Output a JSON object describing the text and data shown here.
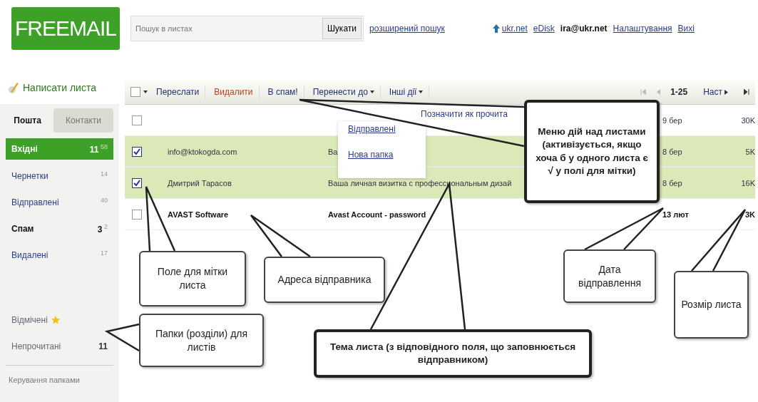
{
  "logo": "FREEMAIL",
  "search": {
    "placeholder": "Пошук в листах",
    "button": "Шукати",
    "advanced_link": "розширений пошук"
  },
  "top_links": [
    {
      "kind": "home",
      "label": "ukr.net"
    },
    {
      "kind": "link",
      "label": "eDisk"
    },
    {
      "kind": "account",
      "label": "ira@ukr.net"
    },
    {
      "kind": "link",
      "label": "Налаштування"
    },
    {
      "kind": "link",
      "label": "Вихі"
    }
  ],
  "compose": "Написати листа",
  "sidebar": {
    "tabs": [
      {
        "label": "Пошта",
        "selected": true
      },
      {
        "label": "Контакти",
        "selected": false
      }
    ],
    "folders": [
      {
        "label": "Вхідні",
        "count": "11",
        "total": "58",
        "selected": true
      },
      {
        "label": "Чернетки",
        "total": "14",
        "selected": false
      },
      {
        "label": "Відправлені",
        "total": "40",
        "selected": false
      },
      {
        "label": "Спам",
        "count": "3",
        "total": "2",
        "selected": false
      },
      {
        "label": "Видалені",
        "total": "17",
        "selected": false
      }
    ],
    "filters": [
      {
        "kind": "starred",
        "label": "Відмічені",
        "selected": false
      },
      {
        "kind": "plain",
        "label": "Непрочитані",
        "count": "11",
        "selected": false
      }
    ],
    "manage_folders": "Керування папками"
  },
  "toolbar": {
    "select_all": {
      "checked": false
    },
    "actions": [
      {
        "kind": "button",
        "label": "Переслати"
      },
      {
        "kind": "danger",
        "label": "Видалити"
      },
      {
        "kind": "button",
        "label": "В спам!"
      },
      {
        "kind": "dropdown",
        "label": "Перенести до"
      },
      {
        "kind": "dropdown",
        "label": "Інші дії"
      }
    ],
    "pager": {
      "range": "1-25",
      "next": "Наст"
    }
  },
  "move_menu": {
    "items": [
      "Відправлені",
      "Нова папка"
    ]
  },
  "other_menu": {
    "items": [
      "Позначити як прочита"
    ]
  },
  "messages": [
    {
      "checked": false,
      "unread": false,
      "date": "9 бер",
      "size": "30K"
    },
    {
      "checked": true,
      "unread": false,
      "sender": "info@ktokogda.com",
      "subject": "Ва",
      "date": "8 бер",
      "size": "5K"
    },
    {
      "checked": true,
      "unread": false,
      "sender": "Дмитрий Тарасов",
      "subject": "Ваша личная визитка с профессиональным дизай",
      "date": "8 бер",
      "size": "16K"
    },
    {
      "checked": false,
      "unread": true,
      "sender": "AVAST Software",
      "subject": "Avast Account - password",
      "date": "13 лют",
      "size": "3K"
    }
  ],
  "callouts": [
    {
      "kind": "strong",
      "text": "Меню дій над листами (активізується, якщо хоча б у одного листа є √ у полі для мітки)"
    },
    {
      "kind": "normal",
      "text": "Поле для мітки листа"
    },
    {
      "kind": "normal",
      "text": "Адреса відправника"
    },
    {
      "kind": "normal",
      "text": "Папки (розділи) для листів"
    },
    {
      "kind": "strong",
      "text": "Тема листа (з відповідного поля, що заповнюється відправником)"
    },
    {
      "kind": "normal",
      "text": "Дата відправлення"
    },
    {
      "kind": "normal",
      "text": "Розмір листа"
    }
  ]
}
